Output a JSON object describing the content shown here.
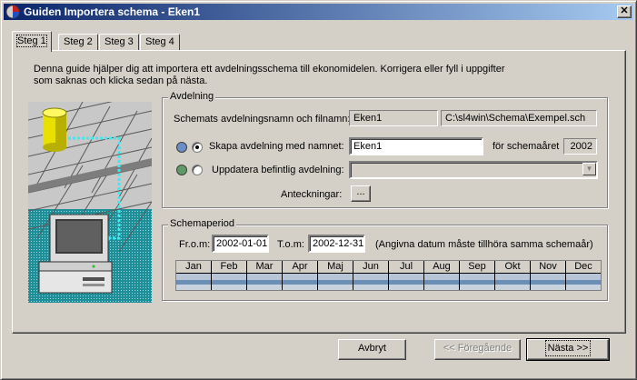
{
  "window": {
    "title": "Guiden Importera schema - Eken1",
    "close_label": "✕"
  },
  "tabs": [
    {
      "label": "Steg 1",
      "active": true
    },
    {
      "label": "Steg 2",
      "active": false
    },
    {
      "label": "Steg 3",
      "active": false
    },
    {
      "label": "Steg 4",
      "active": false
    }
  ],
  "intro_text": "Denna guide hjälper dig att importera ett avdelningsschema till ekonomidelen. Korrigera eller fyll i uppgifter som saknas och klicka sedan på nästa.",
  "avdelning": {
    "group_title": "Avdelning",
    "schema_label": "Schemats avdelningsnamn och filnamn:",
    "schema_name": "Eken1",
    "schema_file": "C:\\sl4win\\Schema\\Exempel.sch",
    "create_label": "Skapa avdelning med namnet:",
    "create_value": "Eken1",
    "year_label": "för schemaåret",
    "year_value": "2002",
    "update_label": "Uppdatera befintlig avdelning:",
    "update_value": "",
    "notes_label": "Anteckningar:",
    "notes_button": "...",
    "create_dot_color": "#6b8fc4",
    "update_dot_color": "#5f9a68"
  },
  "schemaperiod": {
    "group_title": "Schemaperiod",
    "from_label": "Fr.o.m:",
    "from_value": "2002-01-01",
    "to_label": "T.o.m:",
    "to_value": "2002-12-31",
    "note": "(Angivna datum måste tillhöra samma schemaår)",
    "months": [
      "Jan",
      "Feb",
      "Mar",
      "Apr",
      "Maj",
      "Jun",
      "Jul",
      "Aug",
      "Sep",
      "Okt",
      "Nov",
      "Dec"
    ]
  },
  "buttons": {
    "cancel": "Avbryt",
    "previous": "<< Föregående",
    "next": "Nästa >>"
  }
}
